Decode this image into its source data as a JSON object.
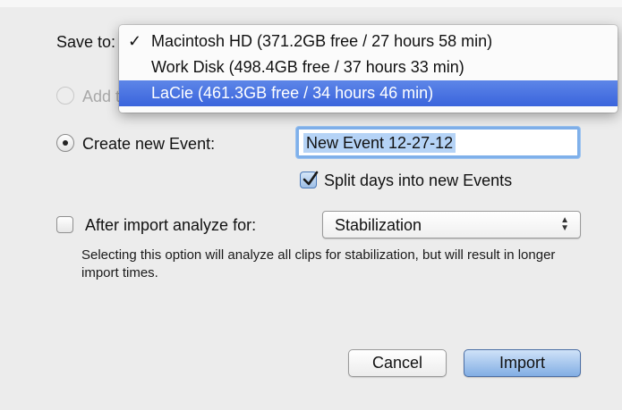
{
  "dialog": {
    "save_to_label": "Save to:",
    "add_event_label": "Add to existing Event:",
    "create_event_label": "Create new Event:",
    "event_name_value": "New Event 12-27-12",
    "split_days_label": "Split days into new Events",
    "analyze_label": "After import analyze for:",
    "analyze_option": "Stabilization",
    "analyze_description": "Selecting this option will analyze all clips for stabilization, but will result in longer import times.",
    "cancel_label": "Cancel",
    "import_label": "Import"
  },
  "save_to_menu": {
    "items": [
      {
        "check": "✓",
        "label": "Macintosh HD (371.2GB free / 27 hours 58 min)"
      },
      {
        "check": "",
        "label": "Work Disk (498.4GB free / 37 hours 33 min)"
      },
      {
        "check": "",
        "label": "LaCie (461.3GB free / 34 hours 46 min)"
      }
    ],
    "highlighted_index": 2
  },
  "state": {
    "add_event_selected": false,
    "create_event_selected": true,
    "split_days_checked": true,
    "analyze_checked": false
  },
  "colors": {
    "menu_highlight": "#3a64dc",
    "default_button": "#82aee4",
    "focus_ring": "#7fb0ea"
  }
}
